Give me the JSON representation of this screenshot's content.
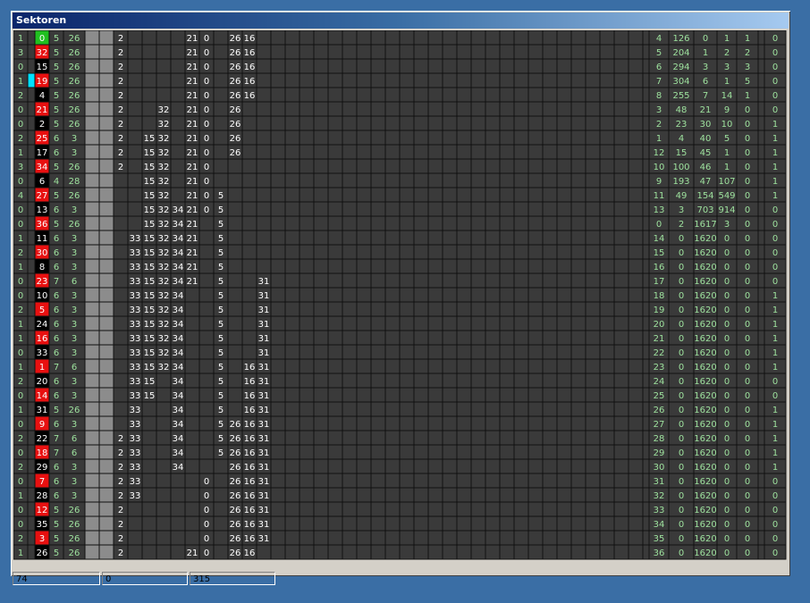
{
  "window": {
    "title": "Sektoren"
  },
  "colors": {
    "cell_bg": "#3a3a3a",
    "grid_line": "#111111",
    "text_green": "#9ee29e",
    "text_white": "#ffffff",
    "highlight_red": "#e81010",
    "highlight_green": "#20c020",
    "highlight_cyan": "#00e0ff",
    "gray_column": "#8c8c8c"
  },
  "grid": {
    "rows": [
      {
        "a": "1",
        "n": "0",
        "nc": "green",
        "b": "5",
        "c": "26",
        "m": [
          "2",
          null,
          null,
          null,
          null,
          "21",
          "0",
          null,
          "26",
          "16",
          null
        ]
      },
      {
        "a": "3",
        "n": "32",
        "nc": "red",
        "b": "5",
        "c": "26",
        "m": [
          "2",
          null,
          null,
          null,
          null,
          "21",
          "0",
          null,
          "26",
          "16",
          null
        ]
      },
      {
        "a": "0",
        "n": "15",
        "nc": "black",
        "b": "5",
        "c": "26",
        "m": [
          "2",
          null,
          null,
          null,
          null,
          "21",
          "0",
          null,
          "26",
          "16",
          null
        ]
      },
      {
        "a": "1",
        "n": "19",
        "nc": "red",
        "b": "5",
        "c": "26",
        "m": [
          "2",
          null,
          null,
          null,
          null,
          "21",
          "0",
          null,
          "26",
          "16",
          null
        ],
        "cyan": true
      },
      {
        "a": "2",
        "n": "4",
        "nc": "black",
        "b": "5",
        "c": "26",
        "m": [
          "2",
          null,
          null,
          null,
          null,
          "21",
          "0",
          null,
          "26",
          "16",
          null
        ]
      },
      {
        "a": "0",
        "n": "21",
        "nc": "red",
        "b": "5",
        "c": "26",
        "m": [
          "2",
          null,
          null,
          "32",
          null,
          "21",
          "0",
          null,
          "26",
          null,
          null
        ]
      },
      {
        "a": "0",
        "n": "2",
        "nc": "black",
        "b": "5",
        "c": "26",
        "m": [
          "2",
          null,
          null,
          "32",
          null,
          "21",
          "0",
          null,
          "26",
          null,
          null
        ]
      },
      {
        "a": "2",
        "n": "25",
        "nc": "red",
        "b": "6",
        "c": "3",
        "m": [
          "2",
          null,
          "15",
          "32",
          null,
          "21",
          "0",
          null,
          "26",
          null,
          null
        ]
      },
      {
        "a": "1",
        "n": "17",
        "nc": "black",
        "b": "6",
        "c": "3",
        "m": [
          "2",
          null,
          "15",
          "32",
          null,
          "21",
          "0",
          null,
          "26",
          null,
          null
        ]
      },
      {
        "a": "3",
        "n": "34",
        "nc": "red",
        "b": "5",
        "c": "26",
        "m": [
          "2",
          null,
          "15",
          "32",
          null,
          "21",
          "0",
          null,
          null,
          null,
          null
        ]
      },
      {
        "a": "0",
        "n": "6",
        "nc": "black",
        "b": "4",
        "c": "28",
        "m": [
          null,
          null,
          "15",
          "32",
          null,
          "21",
          "0",
          null,
          null,
          null,
          null
        ]
      },
      {
        "a": "4",
        "n": "27",
        "nc": "red",
        "b": "5",
        "c": "26",
        "m": [
          null,
          null,
          "15",
          "32",
          null,
          "21",
          "0",
          "5",
          null,
          null,
          null
        ]
      },
      {
        "a": "0",
        "n": "13",
        "nc": "black",
        "b": "6",
        "c": "3",
        "m": [
          null,
          null,
          "15",
          "32",
          "34",
          "21",
          "0",
          "5",
          null,
          null,
          null
        ]
      },
      {
        "a": "0",
        "n": "36",
        "nc": "red",
        "b": "5",
        "c": "26",
        "m": [
          null,
          null,
          "15",
          "32",
          "34",
          "21",
          null,
          "5",
          null,
          null,
          null
        ]
      },
      {
        "a": "1",
        "n": "11",
        "nc": "black",
        "b": "6",
        "c": "3",
        "m": [
          null,
          "33",
          "15",
          "32",
          "34",
          "21",
          null,
          "5",
          null,
          null,
          null
        ]
      },
      {
        "a": "2",
        "n": "30",
        "nc": "red",
        "b": "6",
        "c": "3",
        "m": [
          null,
          "33",
          "15",
          "32",
          "34",
          "21",
          null,
          "5",
          null,
          null,
          null
        ]
      },
      {
        "a": "1",
        "n": "8",
        "nc": "black",
        "b": "6",
        "c": "3",
        "m": [
          null,
          "33",
          "15",
          "32",
          "34",
          "21",
          null,
          "5",
          null,
          null,
          null
        ]
      },
      {
        "a": "0",
        "n": "23",
        "nc": "red",
        "b": "7",
        "c": "6",
        "m": [
          null,
          "33",
          "15",
          "32",
          "34",
          "21",
          null,
          "5",
          null,
          null,
          "31"
        ]
      },
      {
        "a": "0",
        "n": "10",
        "nc": "black",
        "b": "6",
        "c": "3",
        "m": [
          null,
          "33",
          "15",
          "32",
          "34",
          null,
          null,
          "5",
          null,
          null,
          "31"
        ]
      },
      {
        "a": "2",
        "n": "5",
        "nc": "red",
        "b": "6",
        "c": "3",
        "m": [
          null,
          "33",
          "15",
          "32",
          "34",
          null,
          null,
          "5",
          null,
          null,
          "31"
        ]
      },
      {
        "a": "1",
        "n": "24",
        "nc": "black",
        "b": "6",
        "c": "3",
        "m": [
          null,
          "33",
          "15",
          "32",
          "34",
          null,
          null,
          "5",
          null,
          null,
          "31"
        ]
      },
      {
        "a": "1",
        "n": "16",
        "nc": "red",
        "b": "6",
        "c": "3",
        "m": [
          null,
          "33",
          "15",
          "32",
          "34",
          null,
          null,
          "5",
          null,
          null,
          "31"
        ]
      },
      {
        "a": "0",
        "n": "33",
        "nc": "black",
        "b": "6",
        "c": "3",
        "m": [
          null,
          "33",
          "15",
          "32",
          "34",
          null,
          null,
          "5",
          null,
          null,
          "31"
        ]
      },
      {
        "a": "1",
        "n": "1",
        "nc": "red",
        "b": "7",
        "c": "6",
        "m": [
          null,
          "33",
          "15",
          "32",
          "34",
          null,
          null,
          "5",
          null,
          "16",
          "31"
        ]
      },
      {
        "a": "2",
        "n": "20",
        "nc": "black",
        "b": "6",
        "c": "3",
        "m": [
          null,
          "33",
          "15",
          null,
          "34",
          null,
          null,
          "5",
          null,
          "16",
          "31"
        ]
      },
      {
        "a": "0",
        "n": "14",
        "nc": "red",
        "b": "6",
        "c": "3",
        "m": [
          null,
          "33",
          "15",
          null,
          "34",
          null,
          null,
          "5",
          null,
          "16",
          "31"
        ]
      },
      {
        "a": "1",
        "n": "31",
        "nc": "black",
        "b": "5",
        "c": "26",
        "m": [
          null,
          "33",
          null,
          null,
          "34",
          null,
          null,
          "5",
          null,
          "16",
          "31"
        ]
      },
      {
        "a": "0",
        "n": "9",
        "nc": "red",
        "b": "6",
        "c": "3",
        "m": [
          null,
          "33",
          null,
          null,
          "34",
          null,
          null,
          "5",
          "26",
          "16",
          "31"
        ]
      },
      {
        "a": "2",
        "n": "22",
        "nc": "black",
        "b": "7",
        "c": "6",
        "m": [
          "2",
          "33",
          null,
          null,
          "34",
          null,
          null,
          "5",
          "26",
          "16",
          "31"
        ]
      },
      {
        "a": "0",
        "n": "18",
        "nc": "red",
        "b": "7",
        "c": "6",
        "m": [
          "2",
          "33",
          null,
          null,
          "34",
          null,
          null,
          "5",
          "26",
          "16",
          "31"
        ]
      },
      {
        "a": "2",
        "n": "29",
        "nc": "black",
        "b": "6",
        "c": "3",
        "m": [
          "2",
          "33",
          null,
          null,
          "34",
          null,
          null,
          null,
          "26",
          "16",
          "31"
        ]
      },
      {
        "a": "0",
        "n": "7",
        "nc": "red",
        "b": "6",
        "c": "3",
        "m": [
          "2",
          "33",
          null,
          null,
          null,
          null,
          "0",
          null,
          "26",
          "16",
          "31"
        ]
      },
      {
        "a": "1",
        "n": "28",
        "nc": "black",
        "b": "6",
        "c": "3",
        "m": [
          "2",
          "33",
          null,
          null,
          null,
          null,
          "0",
          null,
          "26",
          "16",
          "31"
        ]
      },
      {
        "a": "0",
        "n": "12",
        "nc": "red",
        "b": "5",
        "c": "26",
        "m": [
          "2",
          null,
          null,
          null,
          null,
          null,
          "0",
          null,
          "26",
          "16",
          "31"
        ]
      },
      {
        "a": "0",
        "n": "35",
        "nc": "black",
        "b": "5",
        "c": "26",
        "m": [
          "2",
          null,
          null,
          null,
          null,
          null,
          "0",
          null,
          "26",
          "16",
          "31"
        ]
      },
      {
        "a": "2",
        "n": "3",
        "nc": "red",
        "b": "5",
        "c": "26",
        "m": [
          "2",
          null,
          null,
          null,
          null,
          null,
          "0",
          null,
          "26",
          "16",
          "31"
        ]
      },
      {
        "a": "1",
        "n": "26",
        "nc": "black",
        "b": "5",
        "c": "26",
        "m": [
          "2",
          null,
          null,
          null,
          null,
          "21",
          "0",
          null,
          "26",
          "16",
          null
        ]
      }
    ],
    "right_table": [
      [
        "4",
        "126",
        "0",
        "1",
        "1"
      ],
      [
        "5",
        "204",
        "1",
        "2",
        "2"
      ],
      [
        "6",
        "294",
        "3",
        "3",
        "3"
      ],
      [
        "7",
        "304",
        "6",
        "1",
        "5"
      ],
      [
        "8",
        "255",
        "7",
        "14",
        "1"
      ],
      [
        "3",
        "48",
        "21",
        "9",
        "0"
      ],
      [
        "2",
        "23",
        "30",
        "10",
        "0"
      ],
      [
        "1",
        "4",
        "40",
        "5",
        "0"
      ],
      [
        "12",
        "15",
        "45",
        "1",
        "0"
      ],
      [
        "10",
        "100",
        "46",
        "1",
        "0"
      ],
      [
        "9",
        "193",
        "47",
        "107",
        "0"
      ],
      [
        "11",
        "49",
        "154",
        "549",
        "0"
      ],
      [
        "13",
        "3",
        "703",
        "914",
        "0"
      ],
      [
        "0",
        "2",
        "1617",
        "3",
        "0"
      ],
      [
        "14",
        "0",
        "1620",
        "0",
        "0"
      ],
      [
        "15",
        "0",
        "1620",
        "0",
        "0"
      ],
      [
        "16",
        "0",
        "1620",
        "0",
        "0"
      ],
      [
        "17",
        "0",
        "1620",
        "0",
        "0"
      ],
      [
        "18",
        "0",
        "1620",
        "0",
        "0"
      ],
      [
        "19",
        "0",
        "1620",
        "0",
        "0"
      ],
      [
        "20",
        "0",
        "1620",
        "0",
        "0"
      ],
      [
        "21",
        "0",
        "1620",
        "0",
        "0"
      ],
      [
        "22",
        "0",
        "1620",
        "0",
        "0"
      ],
      [
        "23",
        "0",
        "1620",
        "0",
        "0"
      ],
      [
        "24",
        "0",
        "1620",
        "0",
        "0"
      ],
      [
        "25",
        "0",
        "1620",
        "0",
        "0"
      ],
      [
        "26",
        "0",
        "1620",
        "0",
        "0"
      ],
      [
        "27",
        "0",
        "1620",
        "0",
        "0"
      ],
      [
        "28",
        "0",
        "1620",
        "0",
        "0"
      ],
      [
        "29",
        "0",
        "1620",
        "0",
        "0"
      ],
      [
        "30",
        "0",
        "1620",
        "0",
        "0"
      ],
      [
        "31",
        "0",
        "1620",
        "0",
        "0"
      ],
      [
        "32",
        "0",
        "1620",
        "0",
        "0"
      ],
      [
        "33",
        "0",
        "1620",
        "0",
        "0"
      ],
      [
        "34",
        "0",
        "1620",
        "0",
        "0"
      ],
      [
        "35",
        "0",
        "1620",
        "0",
        "0"
      ],
      [
        "36",
        "0",
        "1620",
        "0",
        "0"
      ]
    ],
    "far_right": [
      "0",
      "0",
      "0",
      "0",
      "0",
      "0",
      "1",
      "1",
      "1",
      "1",
      "1",
      "1",
      "0",
      "0",
      "0",
      "0",
      "0",
      "0",
      "1",
      "1",
      "1",
      "1",
      "1",
      "1",
      "0",
      "0",
      "1",
      "1",
      "1",
      "1",
      "1",
      "0",
      "0",
      "0",
      "0",
      "0",
      "0"
    ]
  },
  "status": [
    "74",
    "0",
    "315"
  ]
}
